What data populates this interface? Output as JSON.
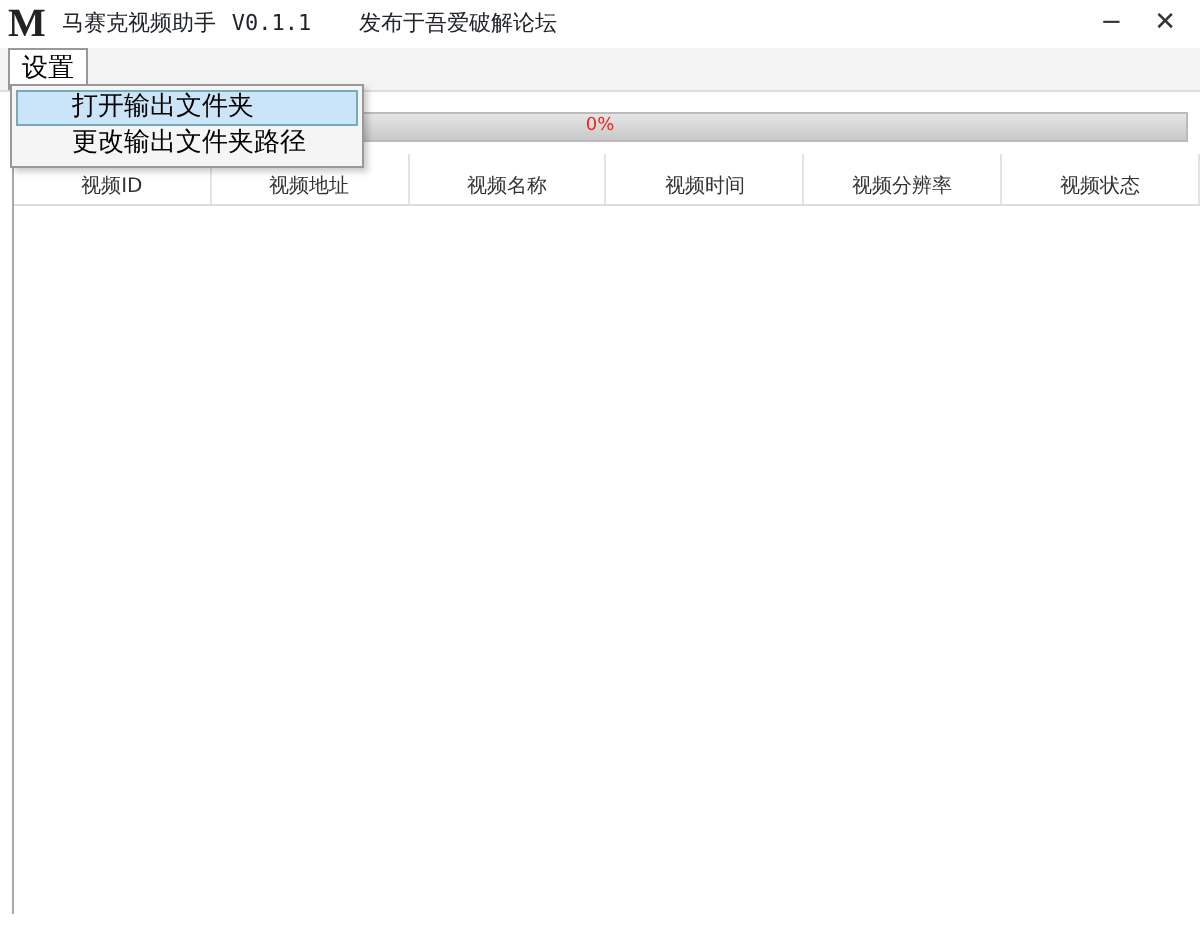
{
  "window": {
    "logo": "M",
    "title": "马赛克视频助手",
    "version": "V0.1.1",
    "subtitle": "发布于吾爱破解论坛",
    "controls": [
      "−",
      "✕"
    ]
  },
  "menubar": [
    {
      "label": "设置",
      "expanded": true
    }
  ],
  "menu": [
    {
      "label": "打开输出文件夹",
      "selected": true
    },
    {
      "label": "更改输出文件夹路径",
      "selected": false
    }
  ],
  "progress": {
    "level": 0,
    "reading": "0%"
  },
  "table": {
    "columns": [
      "视频ID",
      "视频地址",
      "视频名称",
      "视频时间",
      "视频分辨率",
      "视频状态"
    ]
  }
}
